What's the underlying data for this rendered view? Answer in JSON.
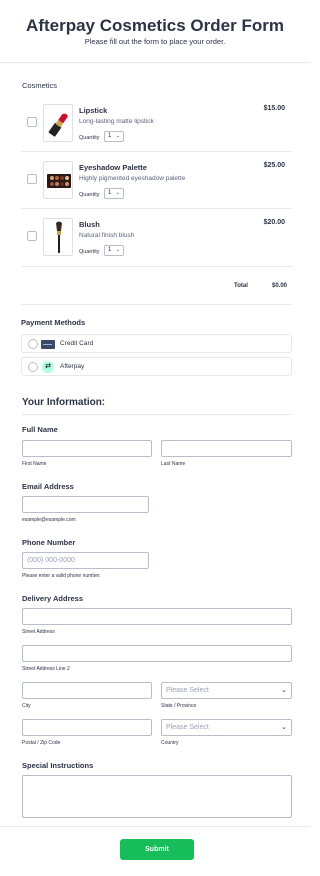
{
  "header": {
    "title": "Afterpay Cosmetics Order Form",
    "subtitle": "Please fill out the form to place your order."
  },
  "products": {
    "section_label": "Cosmetics",
    "quantity_label": "Quantity",
    "items": [
      {
        "name": "Lipstick",
        "description": "Long-lasting matte lipstick",
        "price": "$15.00",
        "quantity": "1",
        "icon": "lipstick-icon"
      },
      {
        "name": "Eyeshadow Palette",
        "description": "Highly pigmented eyeshadow palette",
        "price": "$25.00",
        "quantity": "1",
        "icon": "eyeshadow-palette-icon"
      },
      {
        "name": "Blush",
        "description": "Natural finish blush",
        "price": "$20.00",
        "quantity": "1",
        "icon": "blush-brush-icon"
      }
    ],
    "total_label": "Total",
    "total_value": "$0.00"
  },
  "payment": {
    "title": "Payment Methods",
    "methods": [
      {
        "label": "Credit Card",
        "icon": "credit-card-icon"
      },
      {
        "label": "Afterpay",
        "icon": "afterpay-icon"
      }
    ]
  },
  "info": {
    "title": "Your Information:",
    "full_name": {
      "label": "Full Name",
      "first": "First Name",
      "last": "Last Name"
    },
    "email": {
      "label": "Email Address",
      "sublabel": "example@example.com"
    },
    "phone": {
      "label": "Phone Number",
      "placeholder": "(000) 000-0000",
      "sublabel": "Please enter a valid phone number."
    },
    "address": {
      "label": "Delivery Address",
      "street": "Street Address",
      "street2": "Street Address Line 2",
      "city": "City",
      "state": "State / Province",
      "state_placeholder": "Please Select",
      "postal": "Postal / Zip Code",
      "country": "Country",
      "country_placeholder": "Please Select"
    },
    "instructions": {
      "label": "Special Instructions"
    }
  },
  "submit_label": "Submit",
  "colors": {
    "accent": "#18bd5b",
    "afterpay": "#b2fce4",
    "text": "#2c3345"
  }
}
